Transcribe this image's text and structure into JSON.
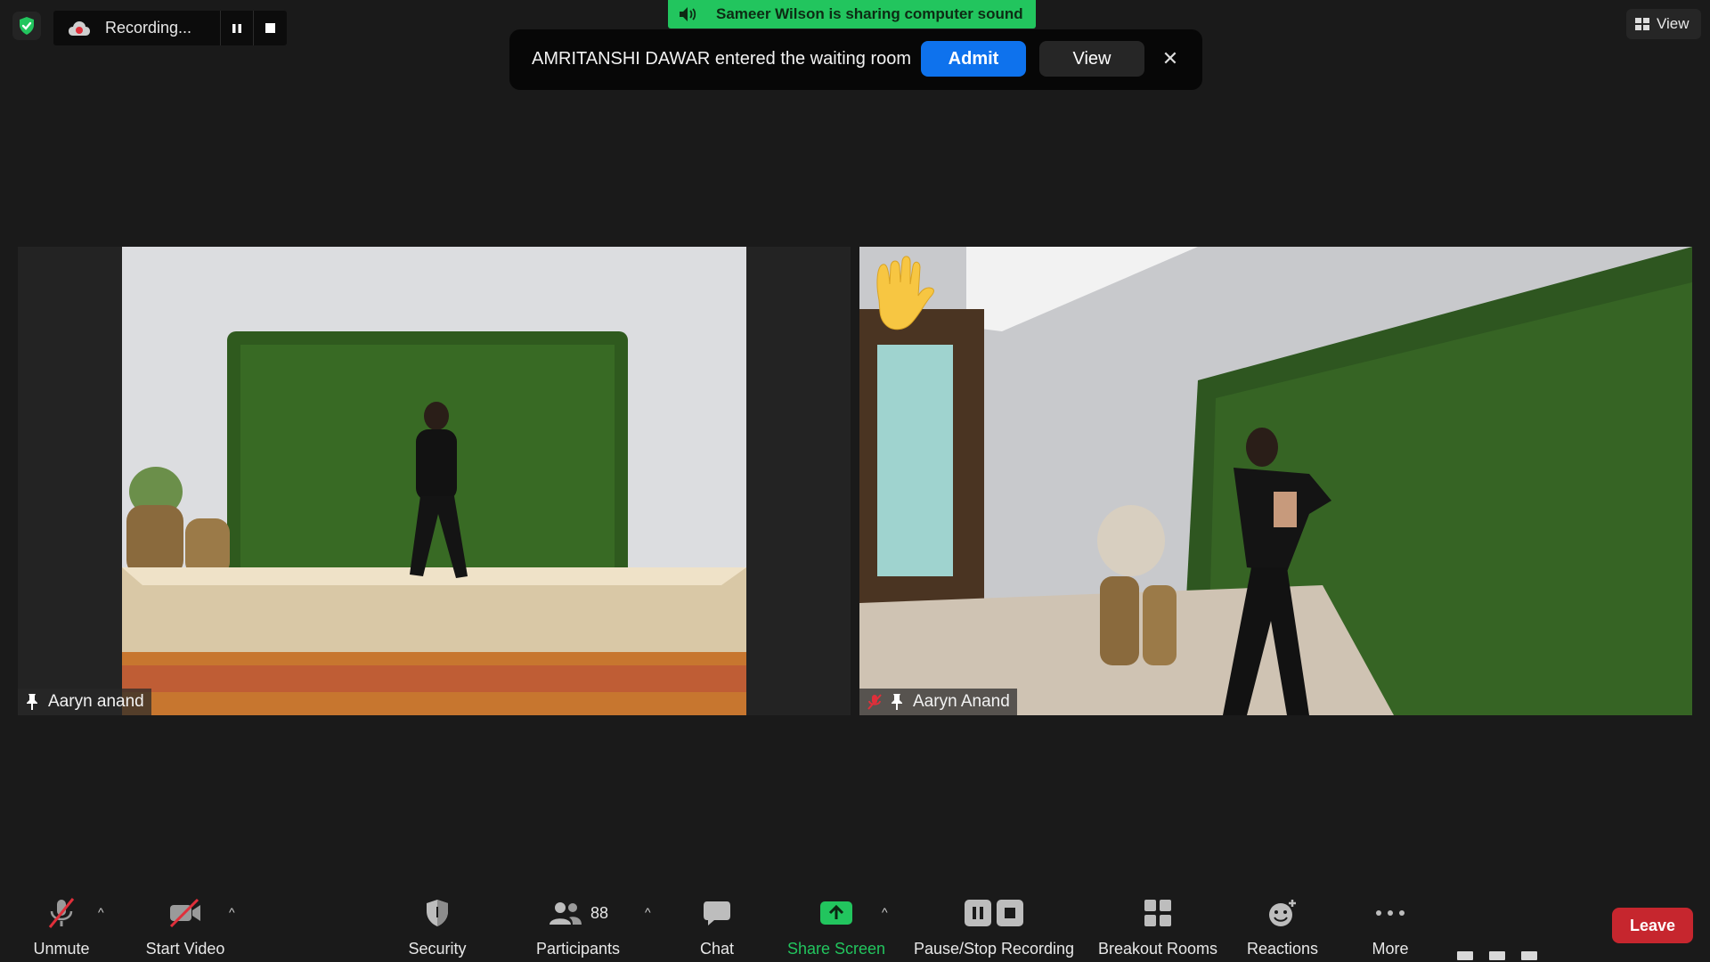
{
  "top_left": {
    "recording_label": "Recording..."
  },
  "share_banner": {
    "text": "Sameer Wilson is sharing computer sound"
  },
  "waiting_room_toast": {
    "message": "AMRITANSHI DAWAR entered the waiting room",
    "admit_label": "Admit",
    "view_label": "View",
    "close_glyph": "✕"
  },
  "view_button": {
    "label": "View"
  },
  "tiles": [
    {
      "name": "Aaryn anand",
      "pinned": true,
      "muted": false,
      "raised_hand": false
    },
    {
      "name": "Aaryn Anand",
      "pinned": true,
      "muted": true,
      "raised_hand": true
    }
  ],
  "toolbar": {
    "unmute_label": "Unmute",
    "start_video_label": "Start Video",
    "security_label": "Security",
    "participants_label": "Participants",
    "participants_count": "88",
    "chat_label": "Chat",
    "share_screen_label": "Share Screen",
    "recording_label": "Pause/Stop Recording",
    "breakout_label": "Breakout Rooms",
    "reactions_label": "Reactions",
    "more_label": "More",
    "leave_label": "Leave",
    "caret_glyph": "^"
  },
  "colors": {
    "background": "#1a1a1a",
    "share_green": "#22c55e",
    "admit_blue": "#0e72ed",
    "leave_red": "#c6262e",
    "muted_red": "#e02f3a"
  },
  "icons": [
    "shield-check-icon",
    "cloud-record-icon",
    "pause-icon",
    "stop-icon",
    "speaker-icon",
    "grid-view-icon",
    "pin-icon",
    "muted-mic-icon",
    "raised-hand-icon",
    "mic-off-icon",
    "video-off-icon",
    "security-shield-icon",
    "participants-icon",
    "chat-icon",
    "share-screen-icon",
    "pause-stop-recording-icon",
    "breakout-rooms-icon",
    "reactions-icon",
    "more-dots-icon"
  ]
}
